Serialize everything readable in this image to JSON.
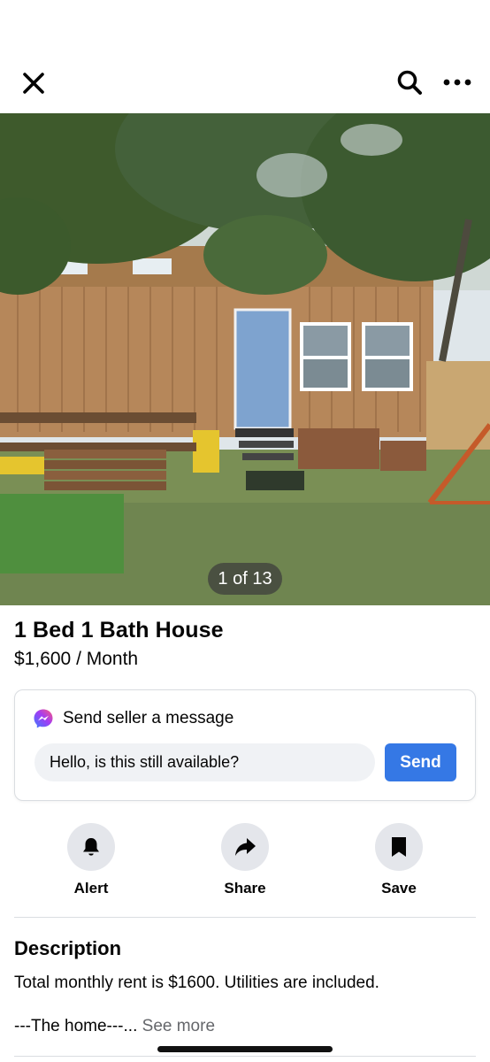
{
  "listing": {
    "title": "1 Bed 1 Bath House",
    "price": "$1,600",
    "price_unit": " / Month",
    "photo_counter": "1 of 13"
  },
  "message_card": {
    "header": "Send seller a message",
    "input_value": "Hello, is this still available?",
    "send_label": "Send"
  },
  "actions": [
    {
      "label": "Alert",
      "icon": "bell-icon"
    },
    {
      "label": "Share",
      "icon": "share-arrow-icon"
    },
    {
      "label": "Save",
      "icon": "bookmark-icon"
    }
  ],
  "description": {
    "heading": "Description",
    "text": "Total monthly rent is $1600. Utilities are included.",
    "preview": "---The home---...",
    "see_more": "See more"
  },
  "colors": {
    "accent": "#3578e5",
    "muted_text": "#65676b"
  }
}
